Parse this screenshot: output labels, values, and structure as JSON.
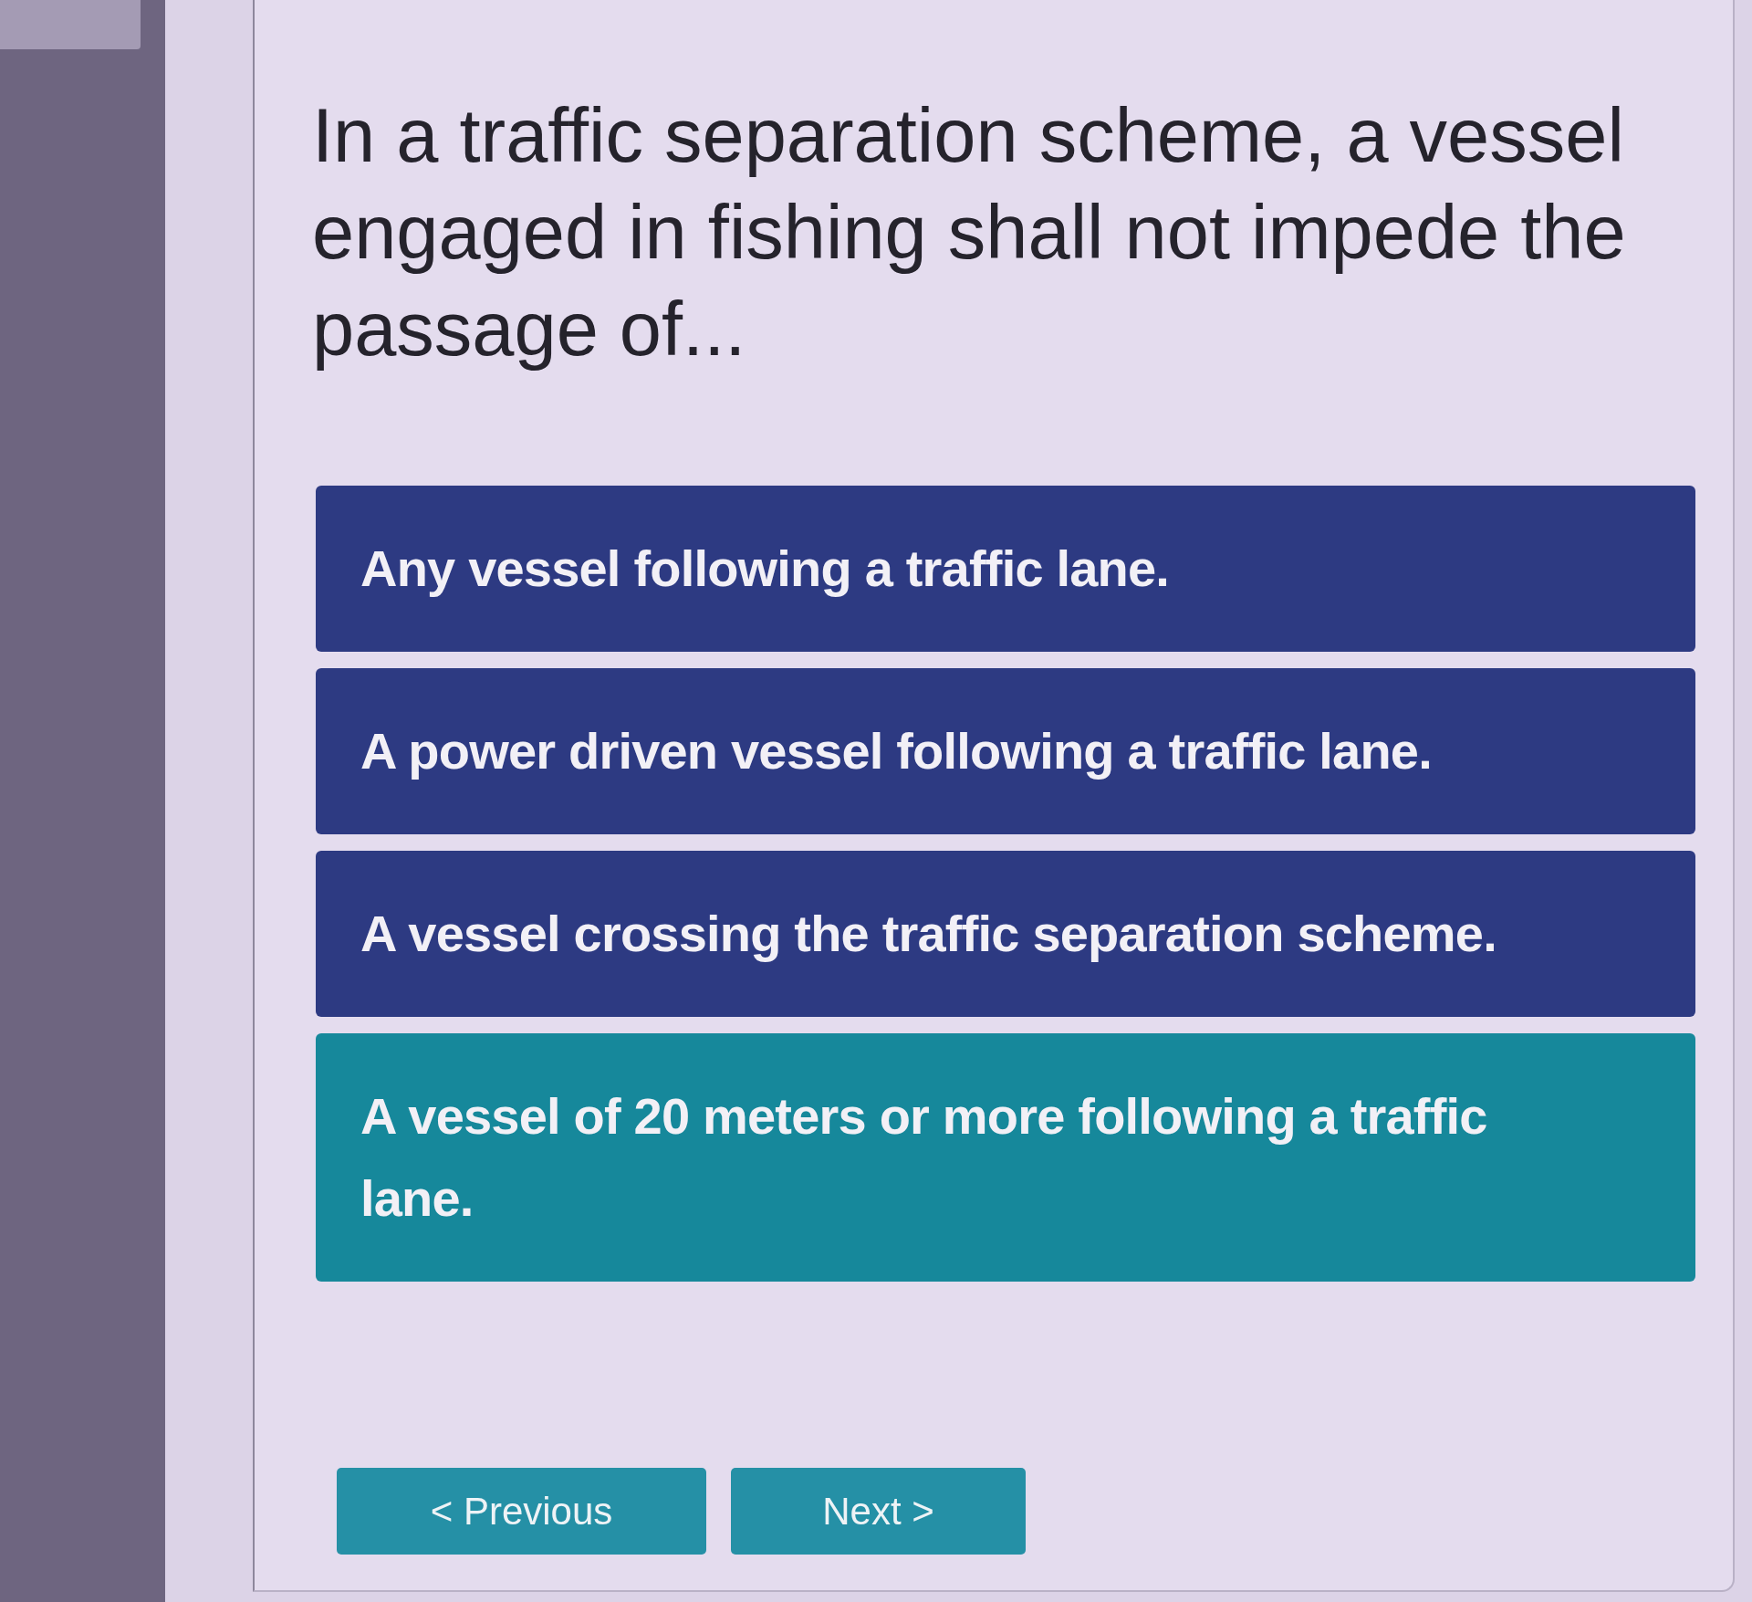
{
  "question": "In a traffic separation scheme, a vessel engaged in fishing shall not impede the passage of...",
  "options": [
    {
      "label": "Any vessel following a traffic lane.",
      "selected": false
    },
    {
      "label": "A power driven vessel following a traffic lane.",
      "selected": false
    },
    {
      "label": "A vessel crossing the traffic separation scheme.",
      "selected": false
    },
    {
      "label": "A vessel of 20 meters or more following a traffic lane.",
      "selected": true
    }
  ],
  "buttons": [
    {
      "label": "< Previous"
    },
    {
      "label": "Next >"
    }
  ]
}
